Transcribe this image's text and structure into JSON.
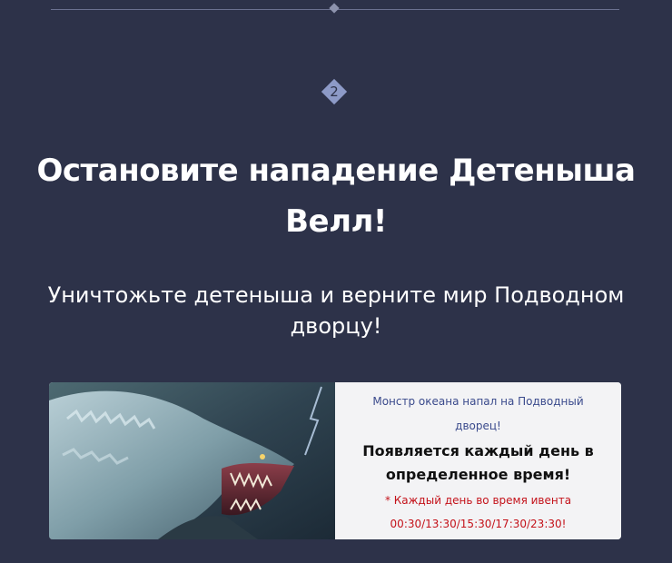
{
  "step": {
    "number": "2"
  },
  "heading": {
    "title_line1": "Остановите нападение Детеныша",
    "title_line2": "Велл!",
    "subtitle_line1": "Уничтожьте детеныша и верните мир Подводном",
    "subtitle_line2": "дворцу!"
  },
  "event_card": {
    "image_icon": "sea-monster-illustration",
    "intro_line1": "Монстр океана напал на Подводный",
    "intro_line2": "дворец!",
    "headline_line1": "Появляется каждый день в",
    "headline_line2": "определенное время!",
    "note": "* Каждый день во время ивента",
    "times": "00:30/13:30/15:30/17:30/23:30!"
  },
  "colors": {
    "background": "#2d3249",
    "badge": "#8d9ac7",
    "intro_text": "#3a4a8c",
    "note_text": "#c4121a"
  }
}
